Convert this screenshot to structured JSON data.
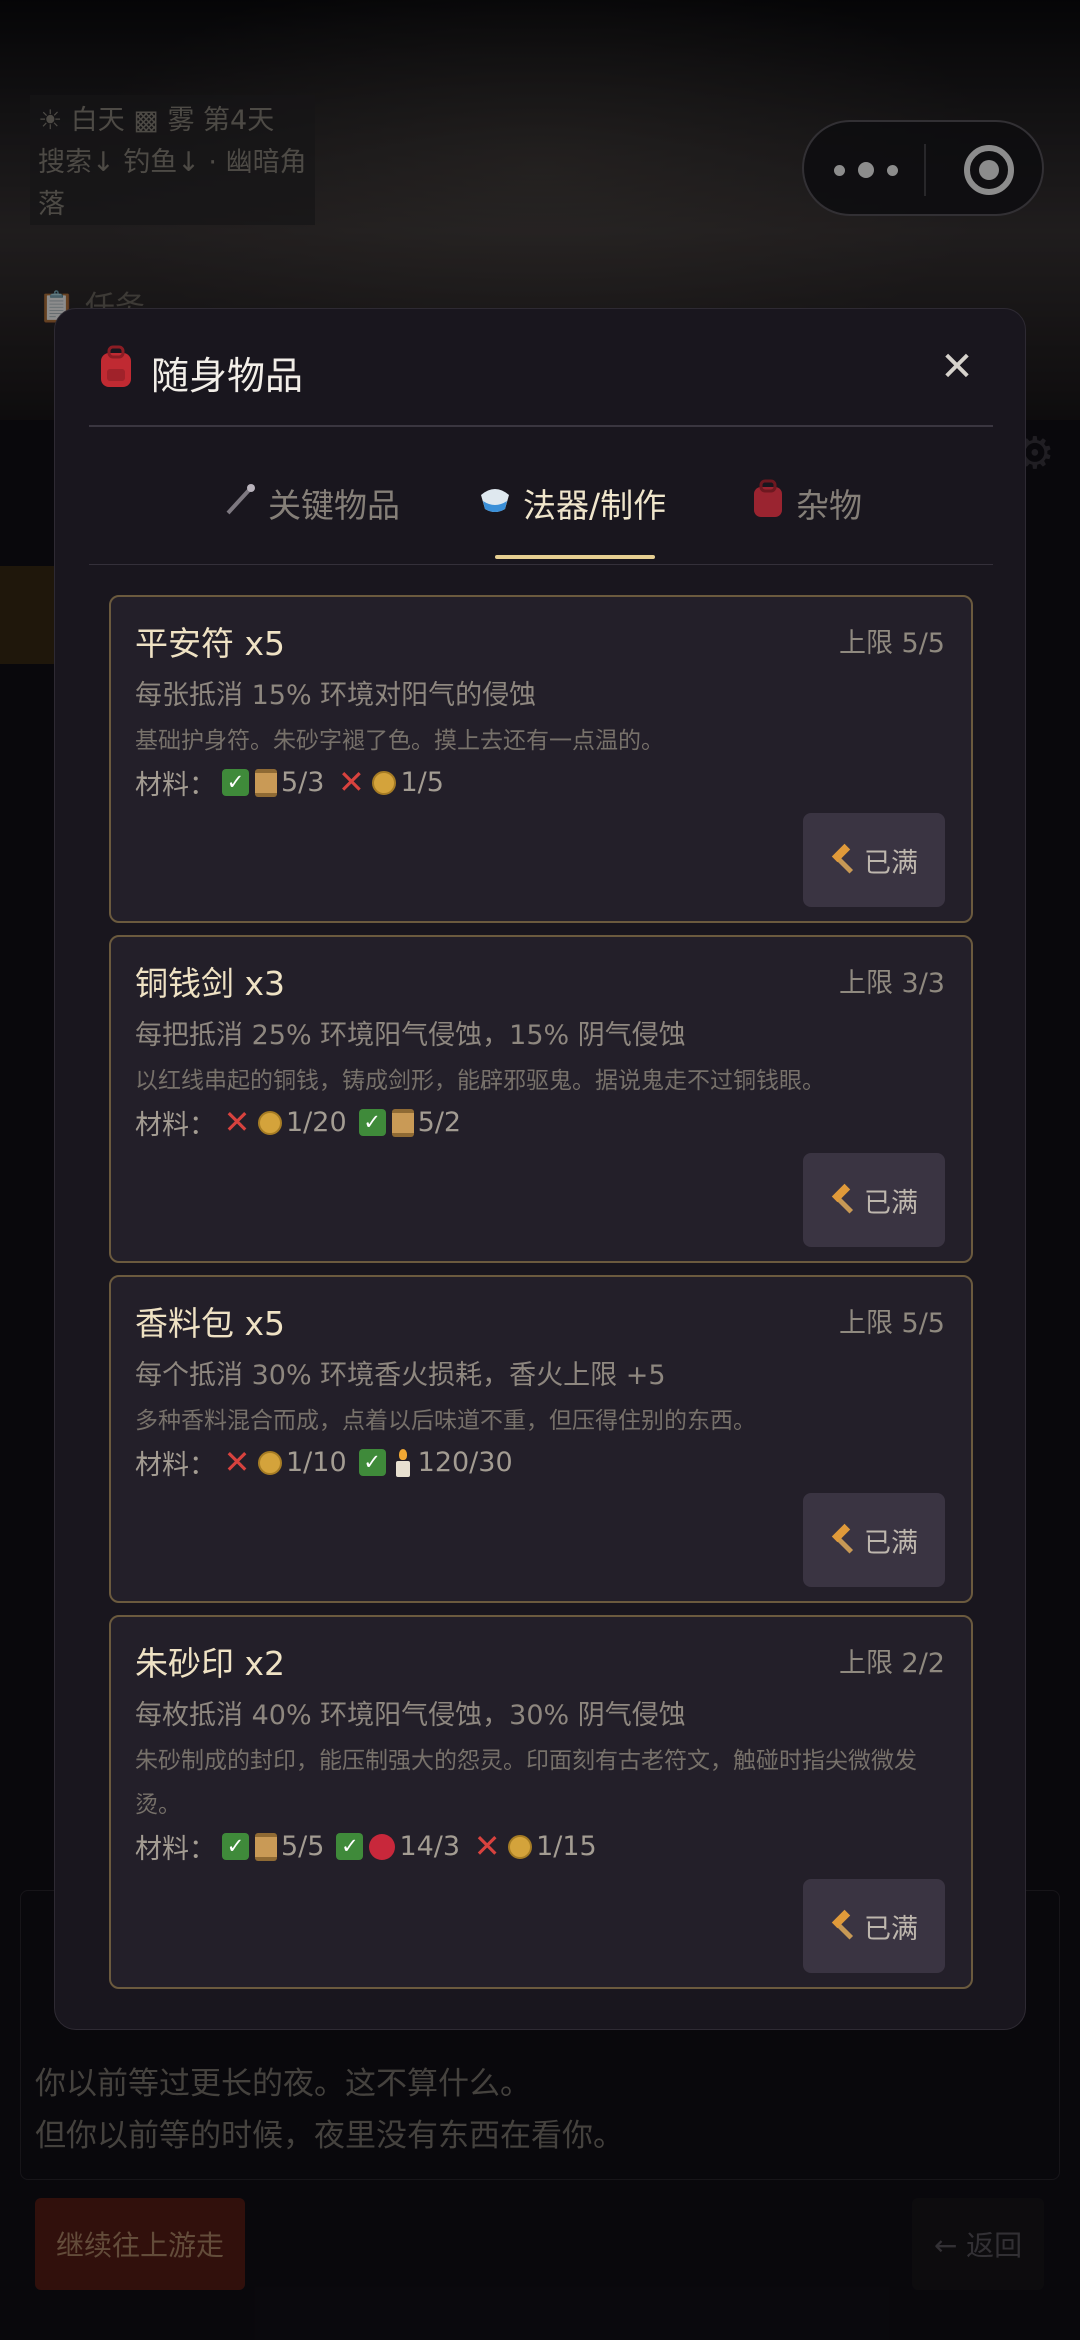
{
  "background": {
    "status_line1": "☀ 白天 ▩ 雾  第4天",
    "status_line2": "搜索↓ 钓鱼↓ · 幽暗角",
    "status_line3": "落",
    "task_label": "📋 任务",
    "story_lines": [
      "你以前等过更长的夜。这不算什么。",
      "但你以前等的时候，夜里没有东西在看你。"
    ],
    "continue_button": "继续往上游走",
    "return_button": "← 返回"
  },
  "modal": {
    "title": "随身物品",
    "close_label": "✕",
    "tabs": [
      {
        "label": "关键物品",
        "icon": "wand-icon",
        "active": false
      },
      {
        "label": "法器/制作",
        "icon": "potion-icon",
        "active": true
      },
      {
        "label": "杂物",
        "icon": "backpack-icon",
        "active": false
      }
    ],
    "items": [
      {
        "name": "平安符 x5",
        "limit": "上限 5/5",
        "effect": "每张抵消 15% 环境对阳气的侵蚀",
        "desc": "基础护身符。朱砂字褪了色。摸上去还有一点温的。",
        "materials_label": "材料：",
        "materials": [
          {
            "ok": true,
            "icon": "scroll-icon",
            "count": "5/3"
          },
          {
            "ok": false,
            "icon": "coin-icon",
            "count": "1/5"
          }
        ],
        "button": "已满"
      },
      {
        "name": "铜钱剑 x3",
        "limit": "上限 3/3",
        "effect": "每把抵消 25% 环境阳气侵蚀，15% 阴气侵蚀",
        "desc": "以红线串起的铜钱，铸成剑形，能辟邪驱鬼。据说鬼走不过铜钱眼。",
        "materials_label": "材料：",
        "materials": [
          {
            "ok": false,
            "icon": "coin-icon",
            "count": "1/20"
          },
          {
            "ok": true,
            "icon": "scroll-icon",
            "count": "5/2"
          }
        ],
        "button": "已满"
      },
      {
        "name": "香料包 x5",
        "limit": "上限 5/5",
        "effect": "每个抵消 30% 环境香火损耗，香火上限 +5",
        "desc": "多种香料混合而成，点着以后味道不重，但压得住别的东西。",
        "materials_label": "材料：",
        "materials": [
          {
            "ok": false,
            "icon": "coin-icon",
            "count": "1/10"
          },
          {
            "ok": true,
            "icon": "candle-icon",
            "count": "120/30"
          }
        ],
        "button": "已满"
      },
      {
        "name": "朱砂印 x2",
        "limit": "上限 2/2",
        "effect": "每枚抵消 40% 环境阳气侵蚀，30% 阴气侵蚀",
        "desc": "朱砂制成的封印，能压制强大的怨灵。印面刻有古老符文，触碰时指尖微微发烫。",
        "materials_label": "材料：",
        "materials": [
          {
            "ok": true,
            "icon": "scroll-icon",
            "count": "5/5"
          },
          {
            "ok": true,
            "icon": "cinnabar-icon",
            "count": "14/3"
          },
          {
            "ok": false,
            "icon": "coin-icon",
            "count": "1/15"
          }
        ],
        "button": "已满"
      }
    ]
  },
  "colors": {
    "accent_gold": "#e6cf92",
    "card_border": "#6b5a3e",
    "ok_green": "#3f8a3a",
    "fail_red": "#d8423e"
  }
}
